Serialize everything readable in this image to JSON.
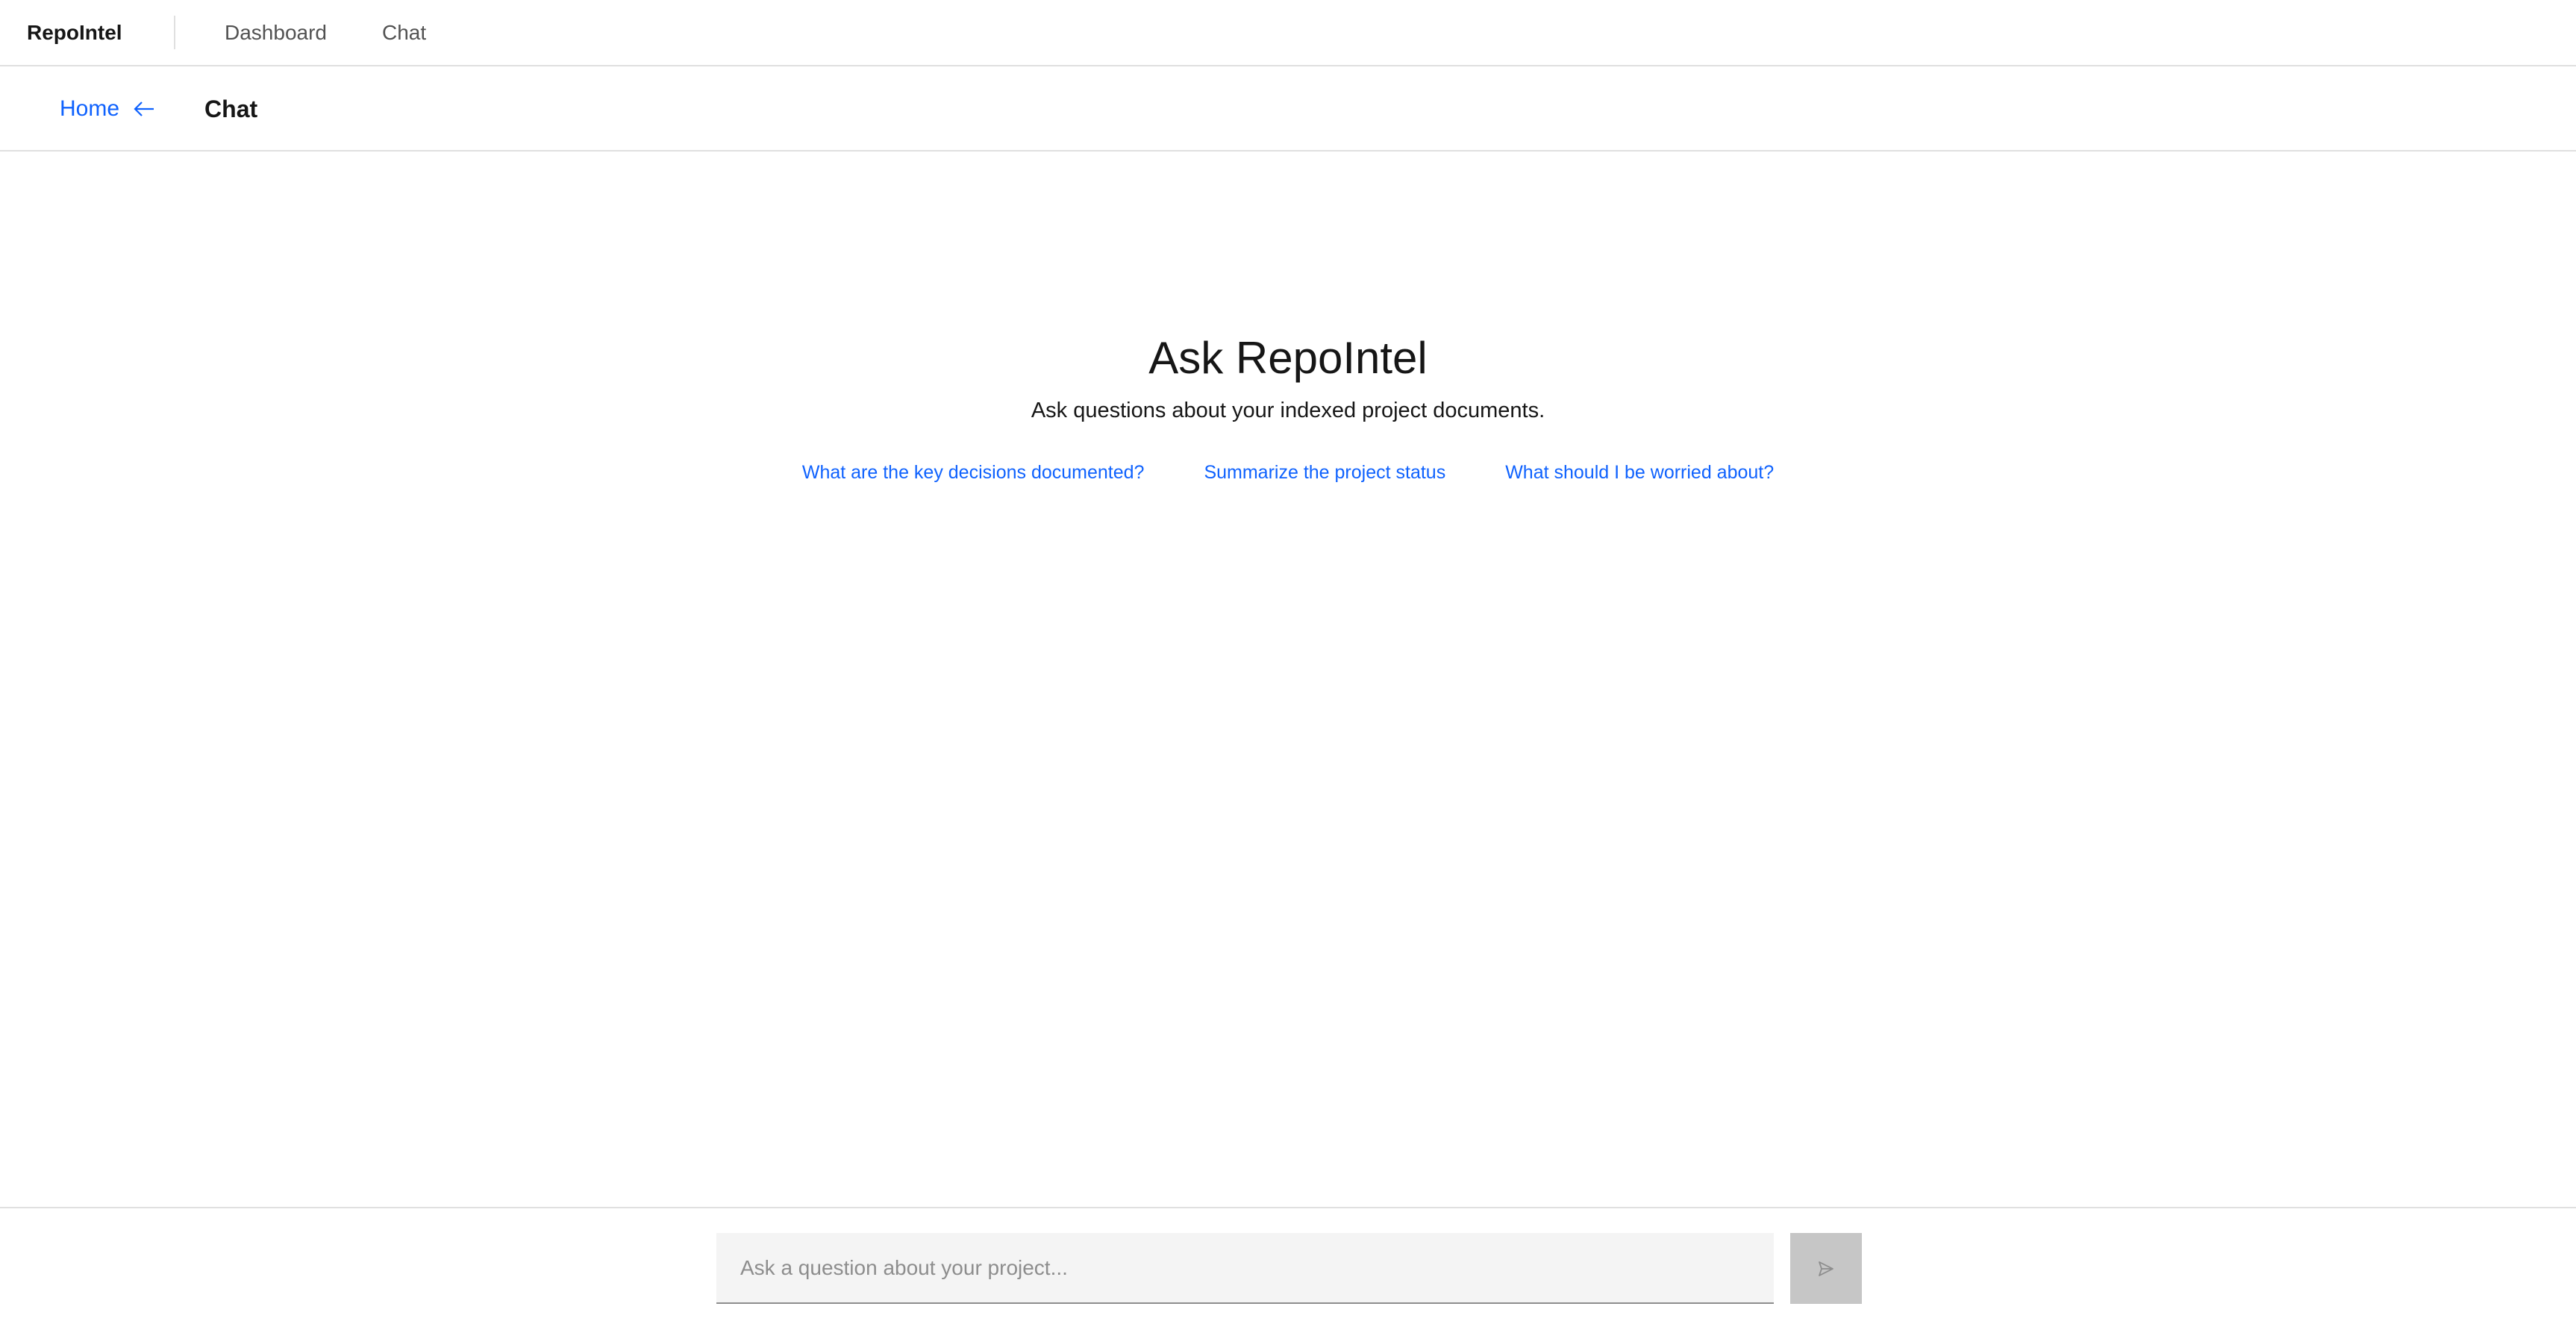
{
  "header": {
    "brand": "RepoIntel",
    "nav": [
      "Dashboard",
      "Chat"
    ]
  },
  "subheader": {
    "back_label": "Home",
    "back_icon": "arrow-left-icon",
    "title": "Chat"
  },
  "welcome": {
    "title": "Ask RepoIntel",
    "subtitle": "Ask questions about your indexed project documents.",
    "suggestions": [
      "What are the key decisions documented?",
      "Summarize the project status",
      "What should I be worried about?"
    ]
  },
  "composer": {
    "placeholder": "Ask a question about your project...",
    "value": "",
    "send_icon": "send-icon"
  },
  "colors": {
    "link": "#0f62fe",
    "border": "#e0e0e0",
    "input_bg": "#f4f4f4",
    "disabled_button": "#c6c6c6"
  }
}
